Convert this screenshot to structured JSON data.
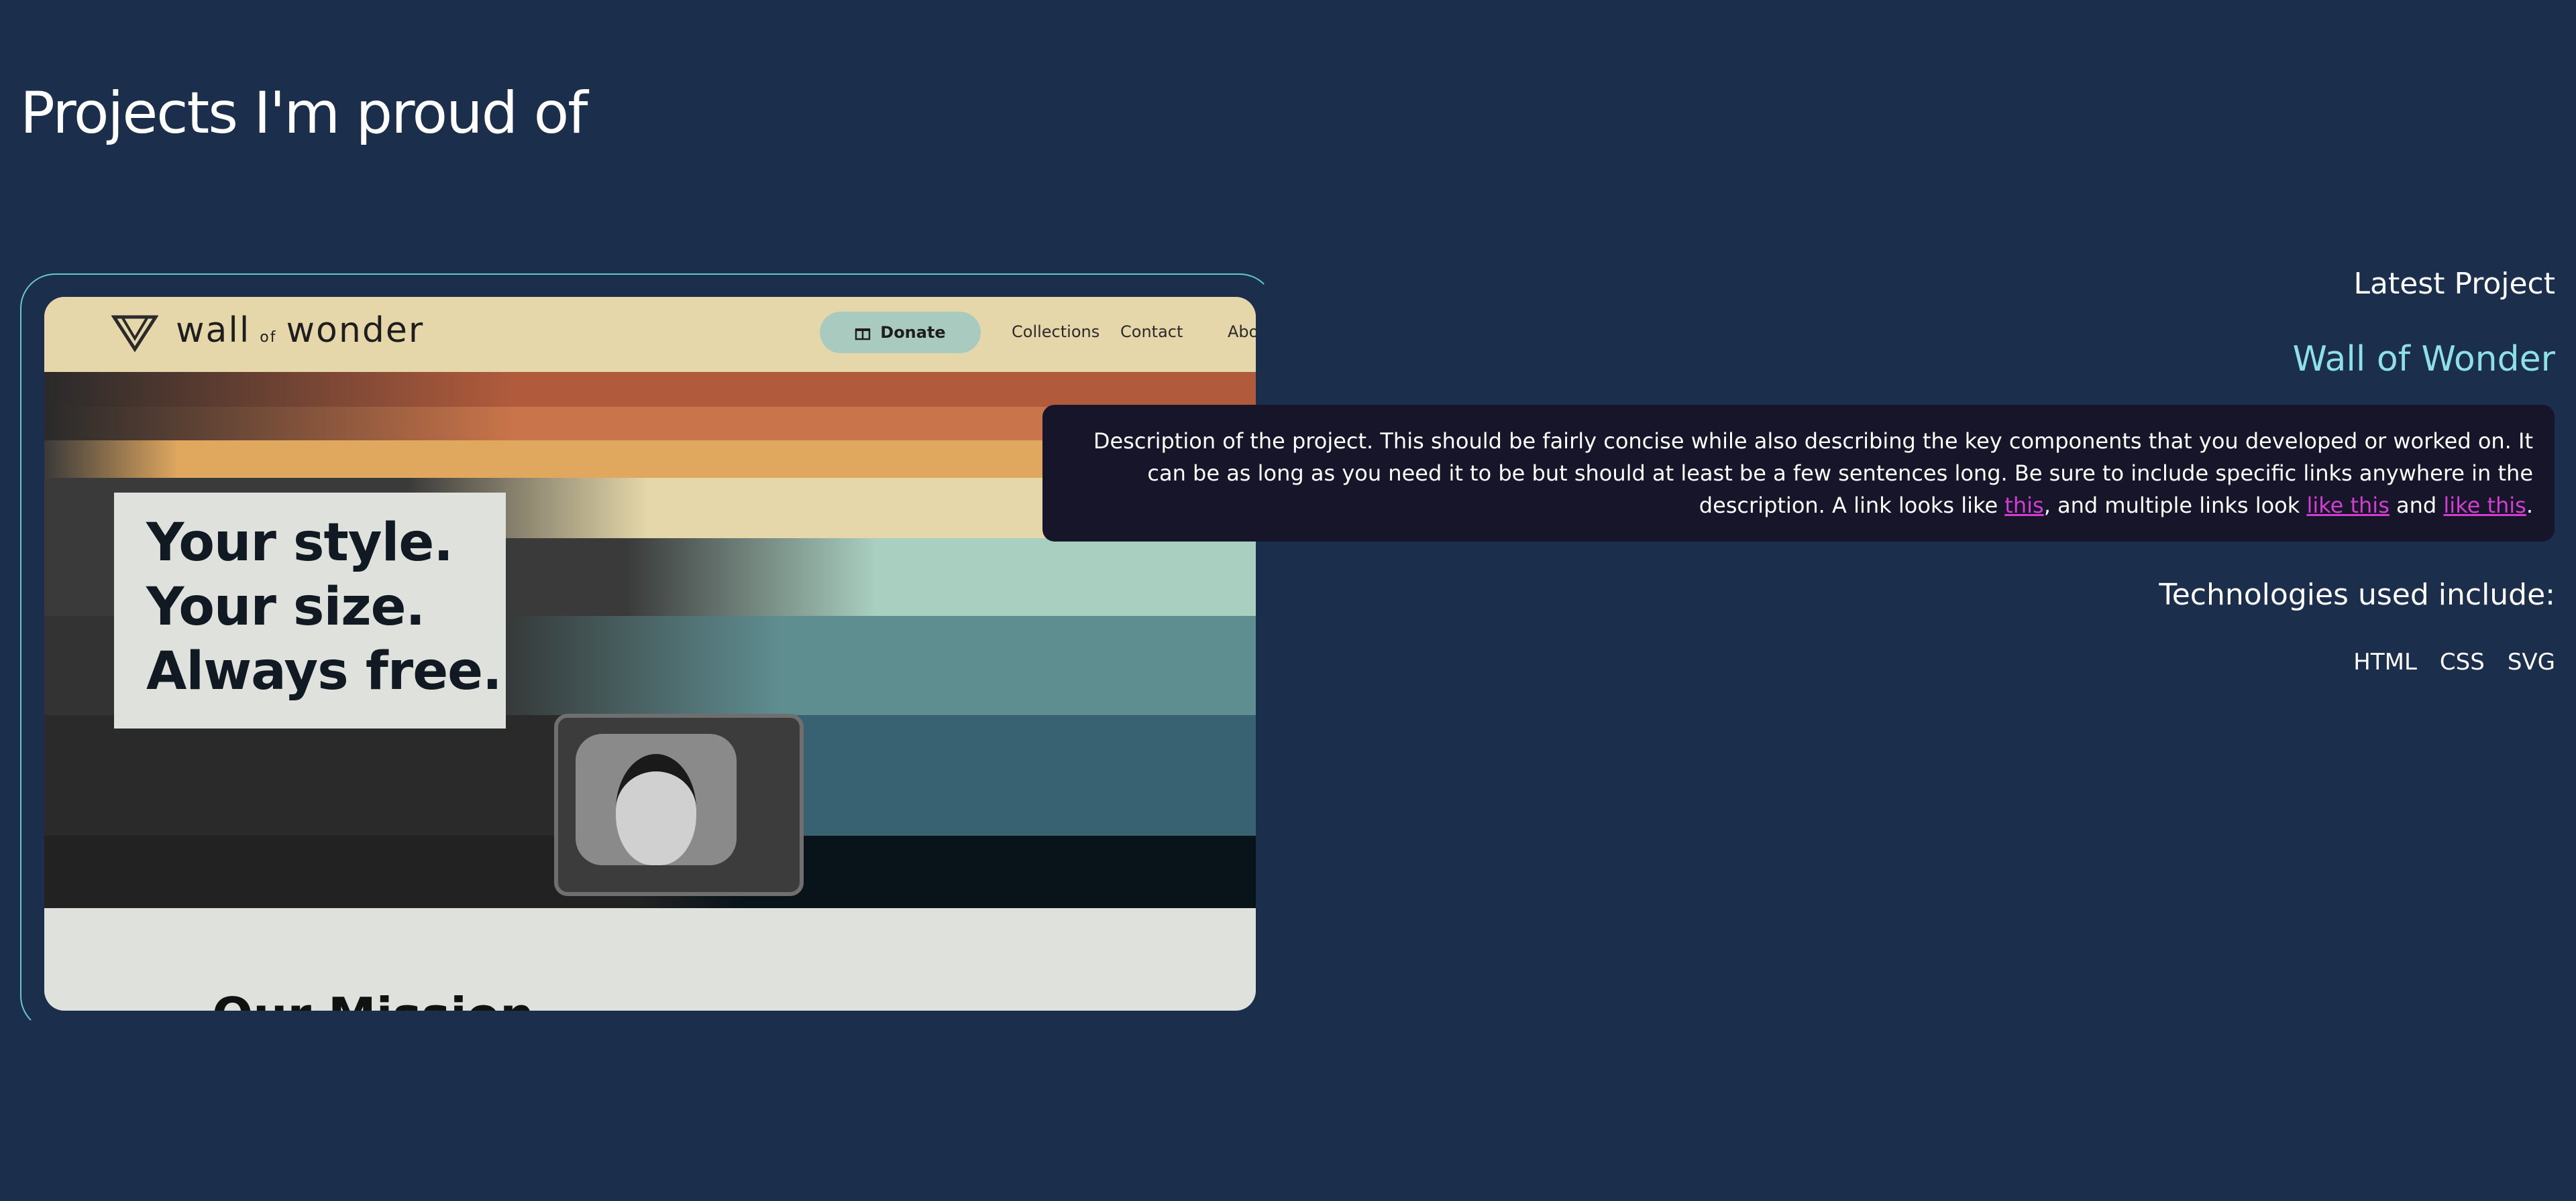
{
  "page": {
    "title": "Projects I'm proud of"
  },
  "project": {
    "section_label": "Latest Project",
    "name": "Wall of Wonder",
    "description": {
      "part1": "Description of the project. This should be fairly concise while also describing the key components that you developed or worked on. It can be as long as you need it to be but should at least be a few sentences long. Be sure to include specific links anywhere in the description. A link looks like ",
      "link1": "this",
      "part2": ", and multiple links look ",
      "link2": "like this",
      "part3": " and ",
      "link3": "like this",
      "part4": "."
    },
    "technologies_label": "Technologies used include:",
    "technologies": [
      "HTML",
      "CSS",
      "SVG"
    ]
  },
  "screenshot": {
    "brand": {
      "word1": "wall",
      "word2": "of",
      "word3": "wonder"
    },
    "donate_label": "Donate",
    "nav_links": [
      "Collections",
      "Contact",
      "Abo"
    ],
    "hero_lines": [
      "Your style.",
      "Your size.",
      "Always free."
    ],
    "mission_heading": "Our Mission"
  },
  "colors": {
    "background": "#1b2e4b",
    "accent": "#8de0e6",
    "link": "#d13ed0",
    "description_box": "#17152a",
    "frame_border": "#62c9d1",
    "stripes": [
      "#b15b3c",
      "#c9744a",
      "#e0a75f",
      "#e5d7aa",
      "#a9cfc0",
      "#5f8e91",
      "#386171",
      "#08141a"
    ]
  }
}
